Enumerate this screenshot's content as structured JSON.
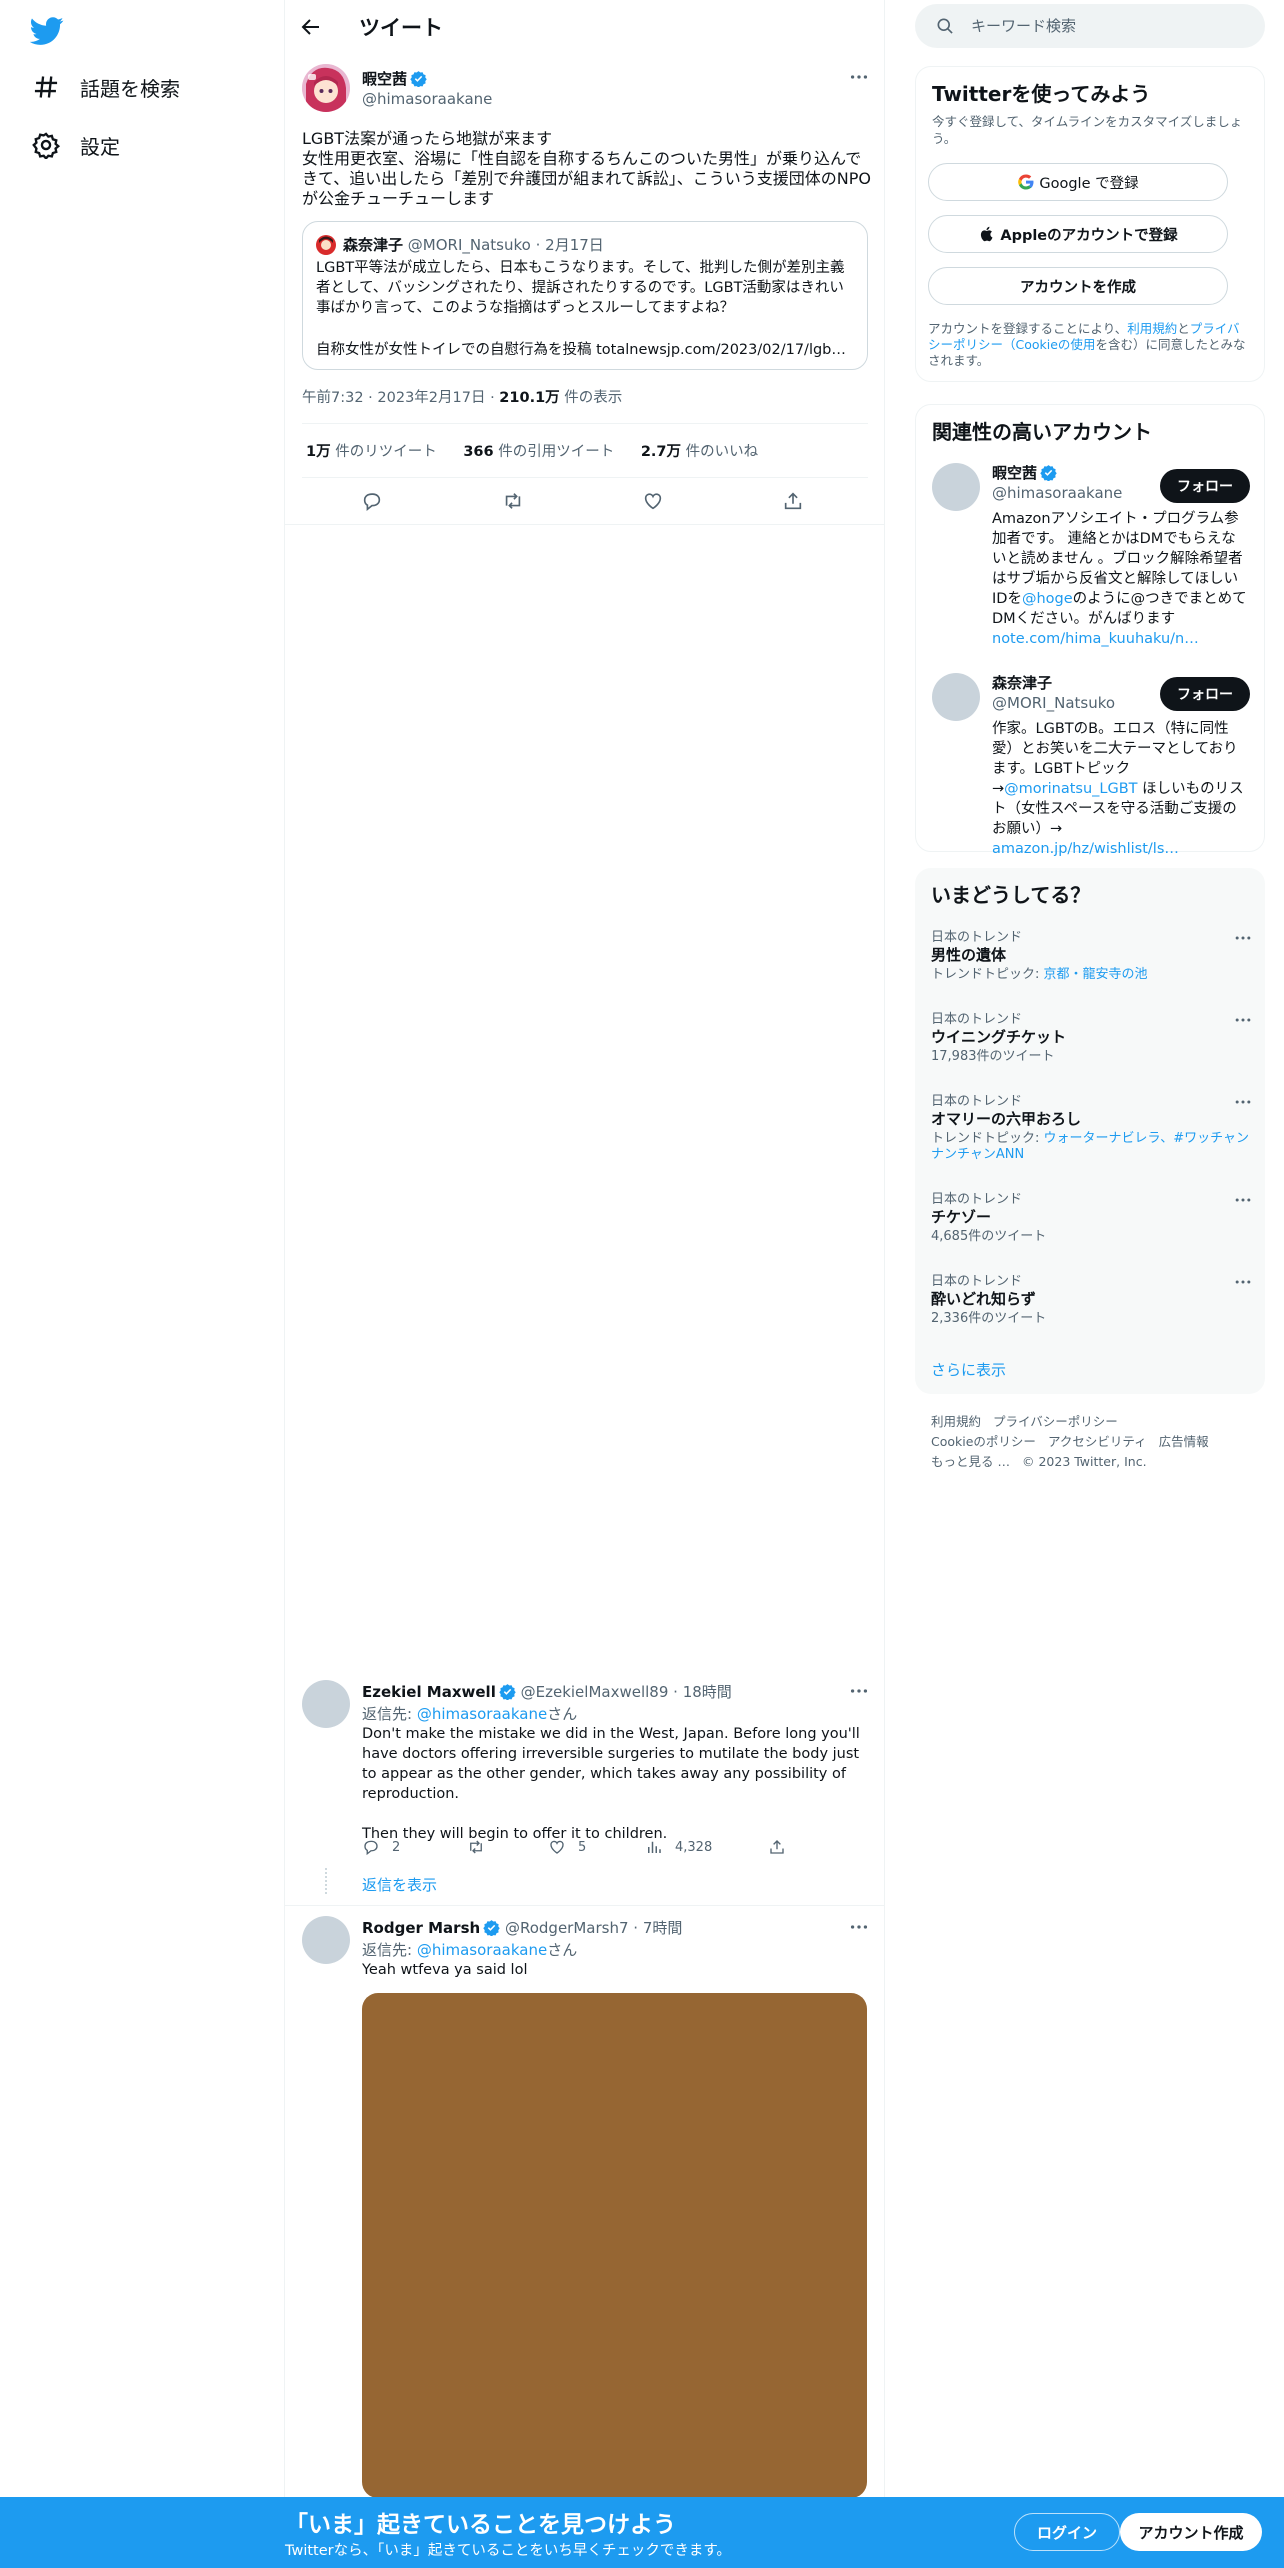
{
  "nav": {
    "explore_label": "話題を検索",
    "settings_label": "設定"
  },
  "header": {
    "title": "ツイート"
  },
  "tweet": {
    "author_name": "暇空茜",
    "author_handle": "@himasoraakane",
    "text": "LGBT法案が通ったら地獄が来ます\n女性用更衣室、浴場に「性自認を自称するちんこのついた男性」が乗り込んできて、追い出したら「差別で弁護団が組まれて訴訟」、こういう支援団体のNPOが公金チューチューします",
    "quote": {
      "author_name": "森奈津子",
      "author_handle": "@MORI_Natsuko",
      "date": "2月17日",
      "text": "LGBT平等法が成立したら、日本もこうなります。そして、批判した側が差別主義者として、バッシングされたり、提訴されたりするのです。LGBT活動家はきれい事ばかり言って、このような指摘はずっとスルーしてますよね？",
      "link_prefix": "自称女性が女性トイレでの自慰行為を投稿 ",
      "link": "totalnewsjp.com/2023/02/17/lgb…"
    },
    "time": "午前7:32",
    "date": "2023年2月17日",
    "views": "210.1万",
    "views_label": "件の表示",
    "retweets": "1万",
    "retweets_label": "件のリツイート",
    "quotes": "366",
    "quotes_label": "件の引用ツイート",
    "likes": "2.7万",
    "likes_label": "件のいいね"
  },
  "replies": [
    {
      "name": "Ezekiel Maxwell",
      "handle": "@EzekielMaxwell89",
      "time": "18時間",
      "reply_to_label": "返信先: ",
      "reply_to_handle": "@himasoraakane",
      "reply_to_suffix": "さん",
      "text": "Don't make the mistake we did in the West, Japan. Before long you'll have doctors offering irreversible surgeries to mutilate the body just to appear as the other gender, which takes away any possibility of reproduction.\n\nThen they will begin to offer it to children.",
      "replies": "2",
      "retweets": "",
      "likes": "5",
      "views": "4,328",
      "show_replies": "返信を表示"
    },
    {
      "name": "Rodger Marsh",
      "handle": "@RodgerMarsh7",
      "time": "7時間",
      "reply_to_label": "返信先: ",
      "reply_to_handle": "@himasoraakane",
      "reply_to_suffix": "さん",
      "text": "Yeah wtfeva ya said lol"
    }
  ],
  "search": {
    "placeholder": "キーワード検索"
  },
  "signup": {
    "title": "Twitterを使ってみよう",
    "subtitle": "今すぐ登録して、タイムラインをカスタマイズしましょう。",
    "google": "Google で登録",
    "apple": "Appleのアカウントで登録",
    "create": "アカウントを作成",
    "terms_1": "アカウントを登録することにより、",
    "terms_link1": "利用規約",
    "terms_2": "と",
    "terms_link2": "プライバシーポリシー（Cookieの使用",
    "terms_3": "を含む）に同意したとみなされます。"
  },
  "related": {
    "title": "関連性の高いアカウント",
    "follow": "フォロー",
    "accounts": [
      {
        "name": "暇空茜",
        "handle": "@himasoraakane",
        "bio_1": "Amazonアソシエイト・プログラム参加者です。 連絡とかはDMでもらえないと読めません 。ブロック解除希望者はサブ垢から反省文と解除してほしいIDを",
        "bio_link1": "@hoge",
        "bio_2": "のように@つきでまとめてDMください。がんばります ",
        "bio_link2": "note.com/hima_kuuhaku/n…"
      },
      {
        "name": "森奈津子",
        "handle": "@MORI_Natsuko",
        "bio_1": "作家。LGBTのB。エロス（特に同性愛）とお笑いを二大テーマとしております。LGBTトピック→",
        "bio_link1": "@morinatsu_LGBT",
        "bio_2": " ほしいものリスト（女性スペースを守る活動ご支援のお願い）→ ",
        "bio_link2": "amazon.jp/hz/wishlist/ls…"
      }
    ]
  },
  "trends": {
    "title": "いまどうしてる？",
    "items": [
      {
        "category": "日本のトレンド",
        "name": "男性の遺体",
        "sub_label": "トレンドトピック: ",
        "sub_link": "京都・龍安寺の池"
      },
      {
        "category": "日本のトレンド",
        "name": "ウイニングチケット",
        "sub_label": "17,983件のツイート",
        "sub_link": ""
      },
      {
        "category": "日本のトレンド",
        "name": "オマリーの六甲おろし",
        "sub_label": "トレンドトピック: ",
        "sub_link": "ウォーターナビレラ、#ワッチャンナンチャンANN"
      },
      {
        "category": "日本のトレンド",
        "name": "チケゾー",
        "sub_label": "4,685件のツイート",
        "sub_link": ""
      },
      {
        "category": "日本のトレンド",
        "name": "酔いどれ知らず",
        "sub_label": "2,336件のツイート",
        "sub_link": ""
      }
    ],
    "show_more": "さらに表示"
  },
  "footer": {
    "terms": "利用規約",
    "privacy": "プライバシーポリシー",
    "cookie": "Cookieのポリシー",
    "accessibility": "アクセシビリティ",
    "ads": "広告情報",
    "more": "もっと見る …",
    "copyright": "© 2023 Twitter, Inc."
  },
  "bottom_bar": {
    "title": "「いま」起きていることを見つけよう",
    "subtitle": "Twitterなら、「いま」起きていることをいち早くチェックできます。",
    "login": "ログイン",
    "signup": "アカウント作成"
  },
  "colors": {
    "accent": "#1d9bf0",
    "text": "#0f1419",
    "muted": "#536471",
    "media": "#966633"
  },
  "icons": [
    "twitter-logo-icon",
    "hashtag-icon",
    "gear-icon",
    "back-arrow-icon",
    "verified-icon",
    "more-icon",
    "reply-icon",
    "retweet-icon",
    "like-icon",
    "share-icon",
    "views-icon",
    "search-icon",
    "google-icon",
    "apple-icon"
  ]
}
